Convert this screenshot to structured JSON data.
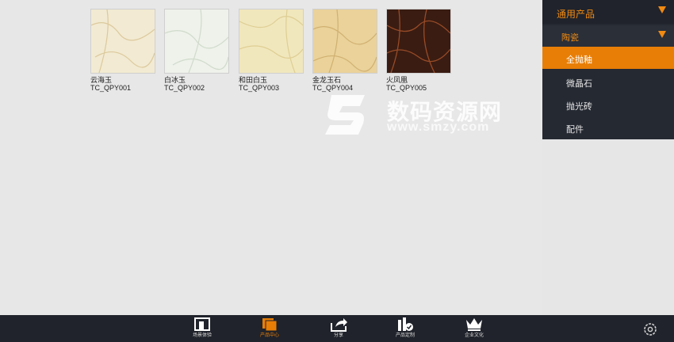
{
  "tiles": [
    {
      "name": "云海玉",
      "code": "TC_QPY001",
      "color": "#f2ead2",
      "vein": "#d6c08e"
    },
    {
      "name": "白冰玉",
      "code": "TC_QPY002",
      "color": "#eef2ea",
      "vein": "#c9d3c4"
    },
    {
      "name": "和田白玉",
      "code": "TC_QPY003",
      "color": "#f1e7bd",
      "vein": "#d9c888"
    },
    {
      "name": "金龙玉石",
      "code": "TC_QPY004",
      "color": "#ead29a",
      "vein": "#c9a765"
    },
    {
      "name": "火凤凰",
      "code": "TC_QPY005",
      "color": "#3a1c12",
      "vein": "#a3512a"
    }
  ],
  "sidebar": {
    "category": "通用产品",
    "subcategory": "陶瓷",
    "items": [
      {
        "label": "全抛釉",
        "active": true
      },
      {
        "label": "微晶石",
        "active": false
      },
      {
        "label": "抛光砖",
        "active": false
      },
      {
        "label": "配件",
        "active": false
      }
    ]
  },
  "bottom_nav": [
    {
      "label": "场景体验",
      "icon": "scene-icon",
      "active": false
    },
    {
      "label": "产品中心",
      "icon": "product-center-icon",
      "active": true
    },
    {
      "label": "分享",
      "icon": "share-icon",
      "active": false
    },
    {
      "label": "产品定制",
      "icon": "customize-icon",
      "active": false
    },
    {
      "label": "企业文化",
      "icon": "crown-icon",
      "active": false
    }
  ],
  "watermark": {
    "title": "数码资源网",
    "subtitle": "www.smzy.com"
  },
  "colors": {
    "accent": "#e87e06",
    "sidebar": "#252932",
    "bar": "#20232b"
  }
}
